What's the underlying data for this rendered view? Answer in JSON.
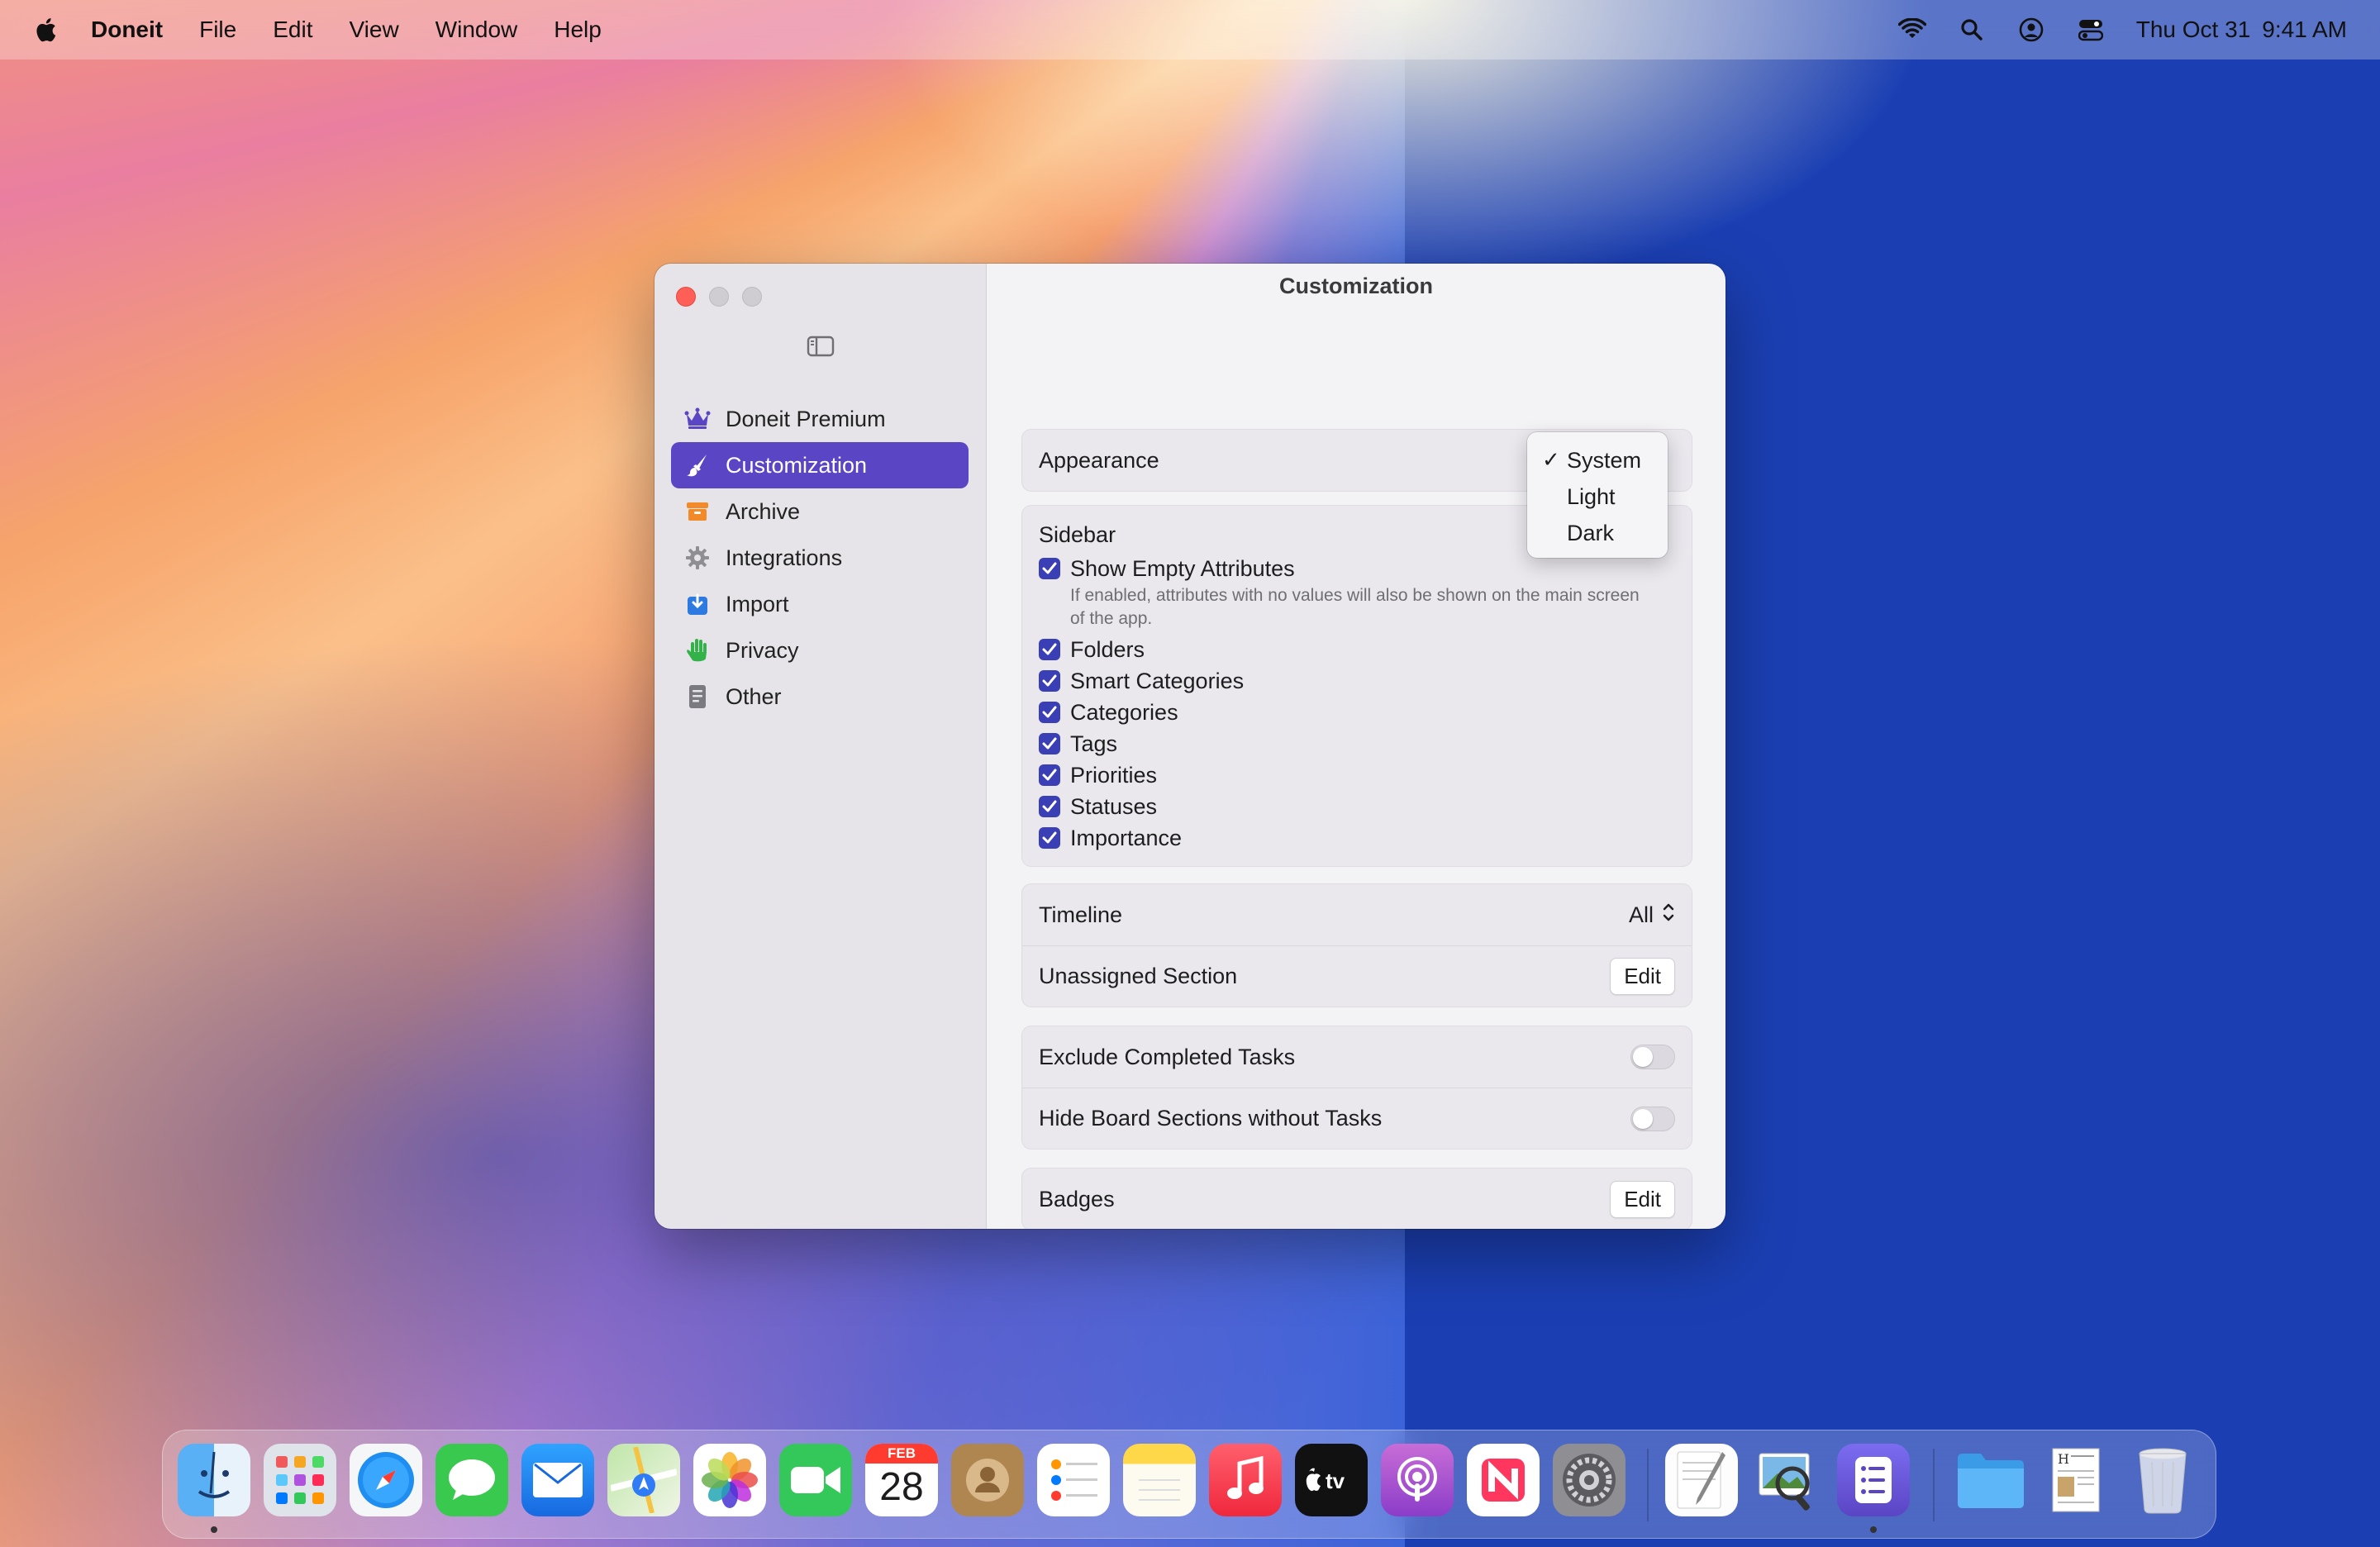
{
  "menubar": {
    "app_name": "Doneit",
    "items": [
      "File",
      "Edit",
      "View",
      "Window",
      "Help"
    ],
    "date": "Thu Oct 31",
    "time": "9:41 AM"
  },
  "window": {
    "title": "Customization",
    "sidebar": {
      "items": [
        {
          "label": "Doneit Premium",
          "icon": "crown-icon",
          "color": "#5a45c4"
        },
        {
          "label": "Customization",
          "icon": "paintbrush-icon",
          "color": "#ffffff",
          "active": true
        },
        {
          "label": "Archive",
          "icon": "archive-box-icon",
          "color": "#f28a2a"
        },
        {
          "label": "Integrations",
          "icon": "gear-icon",
          "color": "#8e8e93"
        },
        {
          "label": "Import",
          "icon": "import-arrow-icon",
          "color": "#2d7be0"
        },
        {
          "label": "Privacy",
          "icon": "hand-icon",
          "color": "#33b24a"
        },
        {
          "label": "Other",
          "icon": "document-icon",
          "color": "#7a7a80"
        }
      ]
    },
    "appearance": {
      "label": "Appearance",
      "options": [
        "System",
        "Light",
        "Dark"
      ],
      "selected": "System"
    },
    "sidebar_section": {
      "title": "Sidebar",
      "show_empty": {
        "label": "Show Empty Attributes",
        "hint": "If enabled, attributes with no values will also be shown on the main screen of the app.",
        "checked": true
      },
      "checks": [
        {
          "label": "Folders",
          "checked": true
        },
        {
          "label": "Smart Categories",
          "checked": true
        },
        {
          "label": "Categories",
          "checked": true
        },
        {
          "label": "Tags",
          "checked": true
        },
        {
          "label": "Priorities",
          "checked": true
        },
        {
          "label": "Statuses",
          "checked": true
        },
        {
          "label": "Importance",
          "checked": true
        }
      ]
    },
    "timeline": {
      "label": "Timeline",
      "value": "All"
    },
    "unassigned": {
      "label": "Unassigned Section",
      "button": "Edit"
    },
    "exclude_completed": {
      "label": "Exclude Completed Tasks",
      "on": false
    },
    "hide_board": {
      "label": "Hide Board Sections without Tasks",
      "on": false
    },
    "badges": {
      "label": "Badges",
      "button": "Edit"
    }
  },
  "dock": {
    "calendar_month": "FEB",
    "calendar_day": "28",
    "apps": [
      "Finder",
      "Launchpad",
      "Safari",
      "Messages",
      "Mail",
      "Maps",
      "Photos",
      "FaceTime",
      "Calendar",
      "Contacts",
      "Reminders",
      "Notes",
      "Music",
      "TV",
      "Podcasts",
      "News",
      "System Settings",
      "TextEdit",
      "Preview",
      "Doneit",
      "Folder",
      "Document",
      "Trash"
    ]
  }
}
